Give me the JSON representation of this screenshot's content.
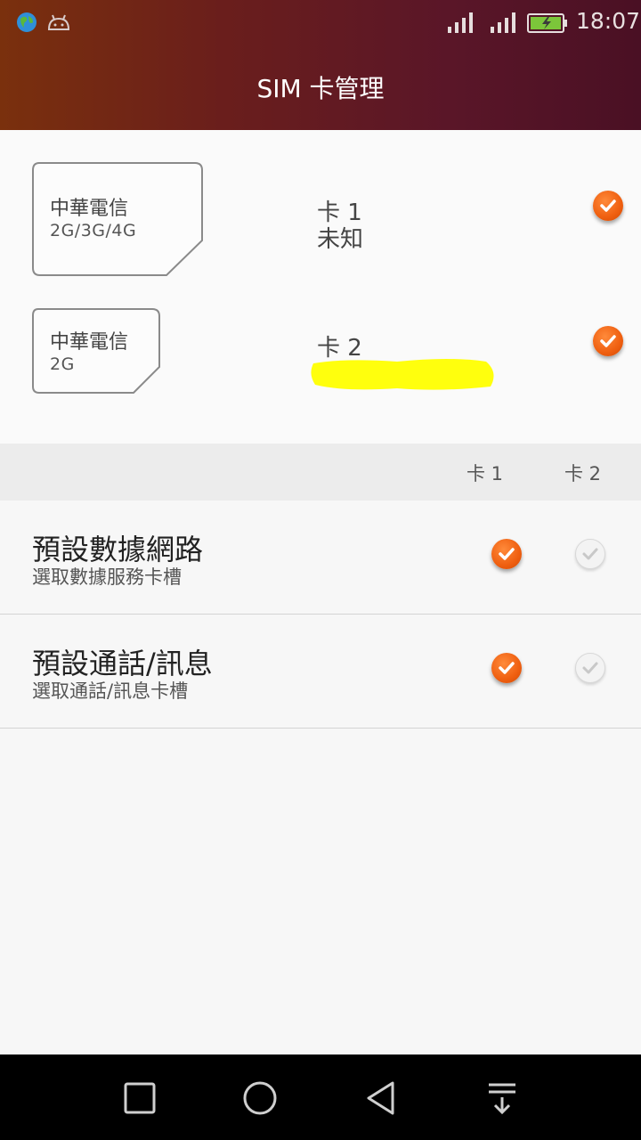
{
  "status_bar": {
    "time": "18:07",
    "icons": [
      "globe-icon",
      "android-icon",
      "signal-icon",
      "signal-icon",
      "battery-charging-icon"
    ]
  },
  "header": {
    "title": "SIM 卡管理"
  },
  "sim_cards": [
    {
      "carrier": "中華電信",
      "network": "2G/3G/4G",
      "slot_label": "卡 1",
      "status": "未知",
      "enabled": true
    },
    {
      "carrier": "中華電信",
      "network": "2G",
      "slot_label": "卡 2",
      "status": "",
      "enabled": true
    }
  ],
  "columns": {
    "card1": "卡 1",
    "card2": "卡 2"
  },
  "preferences": [
    {
      "title": "預設數據網路",
      "subtitle": "選取數據服務卡槽",
      "card1_selected": true,
      "card2_selected": false
    },
    {
      "title": "預設通話/訊息",
      "subtitle": "選取通話/訊息卡槽",
      "card1_selected": true,
      "card2_selected": false
    }
  ],
  "nav": [
    "recent-apps-icon",
    "home-icon",
    "back-icon",
    "notification-pulldown-icon"
  ],
  "colors": {
    "accent": "#ef5f10",
    "header_start": "#7a300d",
    "header_end": "#4a1024",
    "redaction": "#ffff00"
  }
}
